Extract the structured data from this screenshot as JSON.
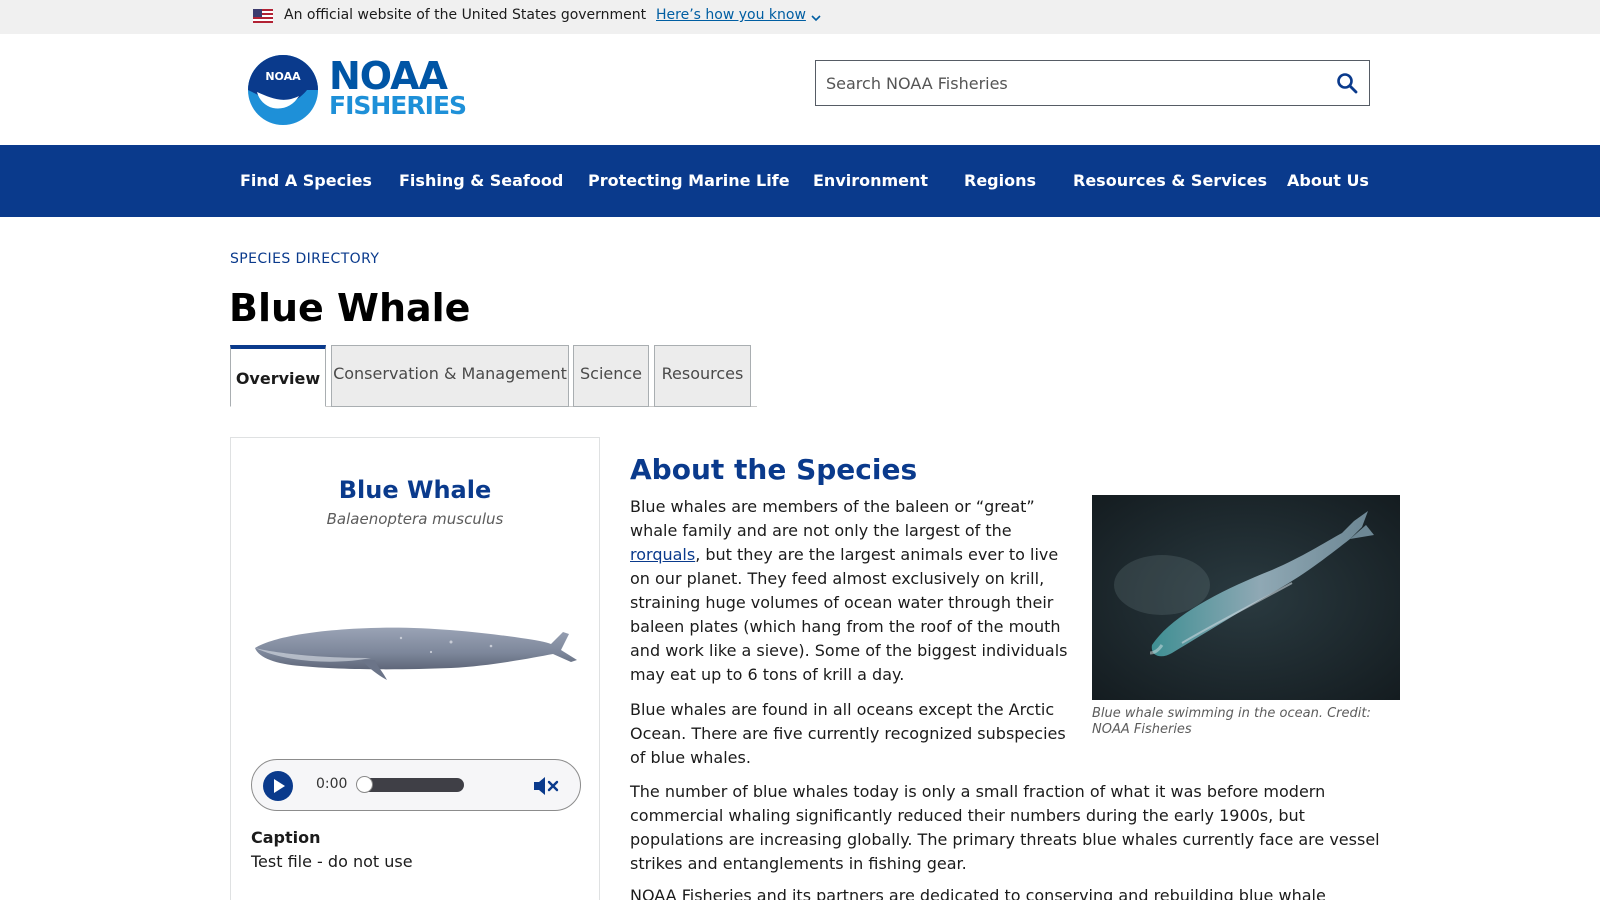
{
  "gov_banner": {
    "text": "An official website of the United States government",
    "link": "Here’s how you know",
    "flag_icon": "us-flag-icon",
    "chevron_icon": "chevron-down-icon"
  },
  "header": {
    "logo_line1": "NOAA",
    "logo_line2": "FISHERIES",
    "logo_emblem": "NOAA",
    "search_placeholder": "Search NOAA Fisheries",
    "search_icon": "search-icon"
  },
  "nav": {
    "items": [
      "Find A Species",
      "Fishing & Seafood",
      "Protecting Marine Life",
      "Environment",
      "Regions",
      "Resources & Services",
      "About Us"
    ]
  },
  "page": {
    "eyebrow": "SPECIES DIRECTORY",
    "title": "Blue Whale"
  },
  "tabs": [
    {
      "label": "Overview",
      "active": true
    },
    {
      "label": "Conservation & Management",
      "active": false
    },
    {
      "label": "Science",
      "active": false
    },
    {
      "label": "Resources",
      "active": false
    }
  ],
  "species_card": {
    "common_name": "Blue Whale",
    "scientific_name": "Balaenoptera musculus",
    "audio": {
      "time": "0:00",
      "progress": 0,
      "play_icon": "play-icon",
      "mute_icon": "muted-speaker-icon"
    },
    "caption_label": "Caption",
    "caption_text": "Test file - do not use"
  },
  "article": {
    "heading": "About the Species",
    "p1_before": "Blue whales are members of the baleen or “great” whale family and are not only the largest of the ",
    "p1_link": "rorquals",
    "p1_after": ", but they are the largest animals ever to live on our planet. They feed almost exclusively on krill, straining huge volumes of ocean water through their baleen plates (which hang from the roof of the mouth and work like a sieve). Some of the biggest individuals may eat up to 6 tons of krill a day.",
    "p2": "Blue whales are found in all oceans except the Arctic Ocean. There are five currently recognized subspecies of blue whales.",
    "p3": "The number of blue whales today is only a small fraction of what it was before modern commercial whaling significantly reduced their numbers during the early 1900s, but populations are increasing globally. The primary threats blue whales currently face are vessel strikes and entanglements in fishing gear.",
    "p4": "NOAA Fisheries and its partners are dedicated to conserving and rebuilding blue whale populations",
    "photo_caption": "Blue whale swimming in the ocean. Credit: NOAA Fisheries"
  },
  "colors": {
    "brand_navy": "#0a3a8c",
    "nav_bg": "#0a3a8c",
    "link": "#005ea2",
    "banner_bg": "#f0f0f0"
  }
}
